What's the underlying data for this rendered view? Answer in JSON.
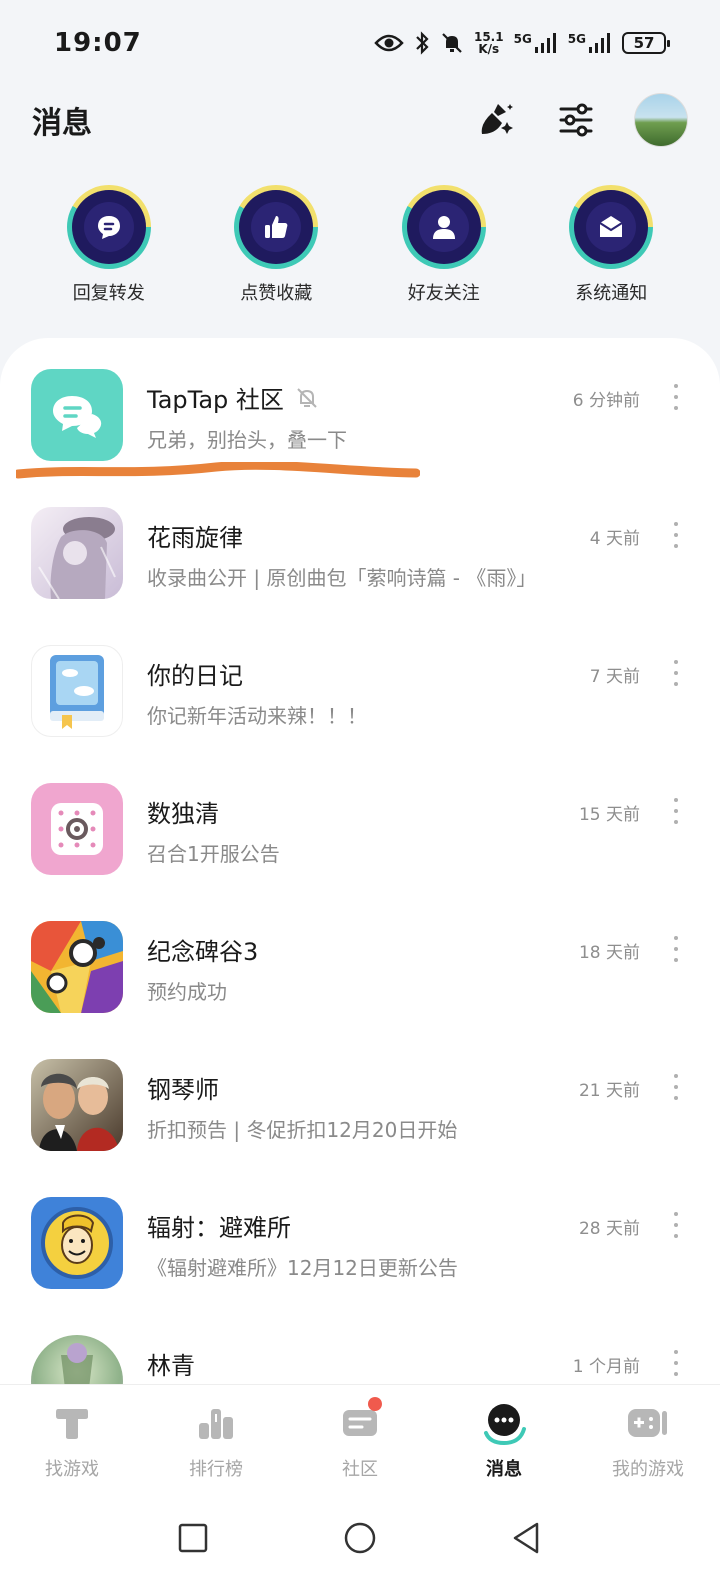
{
  "status_bar": {
    "time": "19:07",
    "net_speed_value": "15.1",
    "net_speed_unit": "K/s",
    "signal_1": "5G",
    "signal_2": "5G",
    "battery": "57",
    "icons": [
      "eye-icon",
      "bluetooth-icon",
      "mute-icon",
      "signal-icon",
      "battery-icon"
    ]
  },
  "header": {
    "title": "消息",
    "actions": [
      "clean-icon",
      "filter-icon",
      "avatar"
    ]
  },
  "categories": [
    {
      "label": "回复转发",
      "icon": "reply-icon"
    },
    {
      "label": "点赞收藏",
      "icon": "thumbs-up-icon"
    },
    {
      "label": "好友关注",
      "icon": "user-icon"
    },
    {
      "label": "系统通知",
      "icon": "mail-icon"
    }
  ],
  "messages": [
    {
      "name": "TapTap 社区",
      "preview": "兄弟，别抬头，叠一下",
      "time": "6 分钟前",
      "muted": true,
      "icon": "taptap-community-icon",
      "color": "#5fd6c4"
    },
    {
      "name": "花雨旋律",
      "preview": "收录曲公开 | 原创曲包「萦响诗篇 - 《雨》」",
      "time": "4 天前",
      "icon": "huayu-game-icon",
      "color": "#d9cfe3"
    },
    {
      "name": "你的日记",
      "preview": "你记新年活动来辣！！！",
      "time": "7 天前",
      "icon": "diary-icon",
      "color": "#6aa6e0"
    },
    {
      "name": "数独清",
      "preview": "召合1开服公告",
      "time": "15 天前",
      "icon": "sudoku-icon",
      "color": "#f0a6cf"
    },
    {
      "name": "纪念碑谷3",
      "preview": "预约成功",
      "time": "18 天前",
      "icon": "monument-valley-icon",
      "color": "#e86b3d"
    },
    {
      "name": "钢琴师",
      "preview": "折扣预告 | 冬促折扣12月20日开始",
      "time": "21 天前",
      "icon": "pianist-icon",
      "color": "#6b2a1f"
    },
    {
      "name": "辐射：避难所",
      "preview": "《辐射避难所》12月12日更新公告",
      "time": "28 天前",
      "icon": "fallout-shelter-icon",
      "color": "#3f82d9"
    },
    {
      "name": "林青",
      "preview": "",
      "time": "1 个月前",
      "icon": "linqing-avatar-icon",
      "color": "#a9c9a0"
    }
  ],
  "bottom_nav": [
    {
      "label": "找游戏",
      "icon": "find-games-icon",
      "active": false
    },
    {
      "label": "排行榜",
      "icon": "ranking-icon",
      "active": false
    },
    {
      "label": "社区",
      "icon": "community-icon",
      "active": false,
      "badge": true
    },
    {
      "label": "消息",
      "icon": "message-icon",
      "active": true
    },
    {
      "label": "我的游戏",
      "icon": "my-games-icon",
      "active": false
    }
  ],
  "system_nav": [
    "recent-apps-icon",
    "home-icon",
    "back-icon"
  ],
  "colors": {
    "accent": "#3ec9b6",
    "badge": "#f05a4d",
    "annotation": "#e8823a",
    "category_bg": "#1f1a5e"
  }
}
